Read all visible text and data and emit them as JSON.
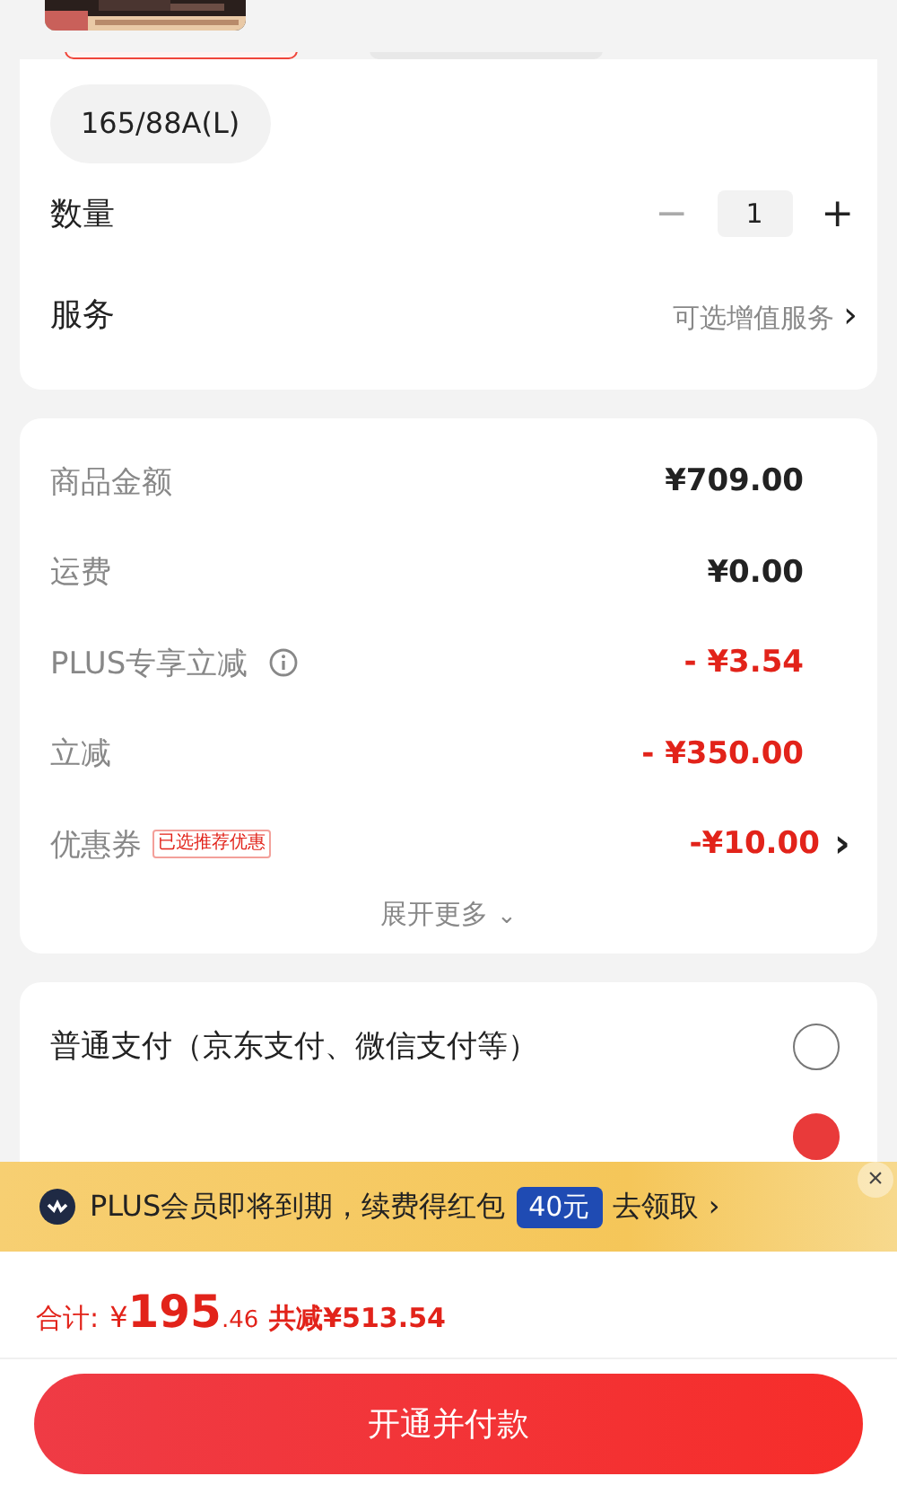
{
  "size_options": [
    {
      "selected": true
    },
    {
      "selected": false
    },
    {
      "label": "165/88A(L)",
      "selected": false
    }
  ],
  "quantity": {
    "label": "数量",
    "minus": "−",
    "value": "1",
    "plus": "+"
  },
  "service": {
    "label": "服务",
    "value": "可选增值服务",
    "arrow": "›"
  },
  "price_rows": [
    {
      "label": "商品金额",
      "value": "¥709.00",
      "discount": false
    },
    {
      "label": "运费",
      "value": "¥0.00",
      "discount": false
    },
    {
      "label": "PLUS专享立减",
      "info": true,
      "value": "- ¥3.54",
      "discount": true
    },
    {
      "label": "立减",
      "value": "- ¥350.00",
      "discount": true
    },
    {
      "label": "优惠券",
      "tag": "已选推荐优惠",
      "value": "-¥10.00",
      "discount": true,
      "arrow": "›"
    }
  ],
  "expand": {
    "label": "展开更多",
    "caret": "⌄"
  },
  "payment_options": [
    {
      "label": "普通支付（京东支付、微信支付等）",
      "selected": false
    },
    {
      "selected": true
    }
  ],
  "banner": {
    "text": "PLUS会员即将到期，续费得红包",
    "badge": "40元",
    "action": "去领取",
    "arrow": "›",
    "close": "×"
  },
  "total": {
    "label": "合计:",
    "currency": "¥",
    "integer": "195",
    "decimal": ".46",
    "saving": "共减¥513.54"
  },
  "submit": {
    "label": "开通并付款"
  }
}
